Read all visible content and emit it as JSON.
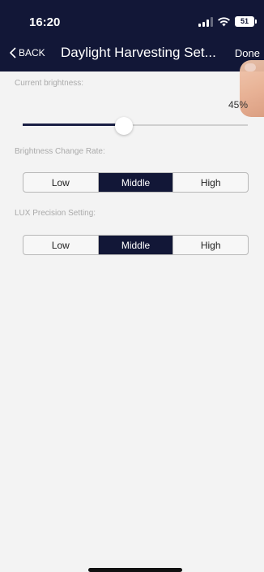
{
  "status_bar": {
    "time": "16:20",
    "battery": "51"
  },
  "nav": {
    "back_label": "BACK",
    "title": "Daylight Harvesting Set...",
    "done_label": "Done"
  },
  "brightness": {
    "label": "Current brightness:",
    "value_text": "45%",
    "value": 0.45
  },
  "change_rate": {
    "label": "Brightness Change Rate:",
    "options": [
      "Low",
      "Middle",
      "High"
    ],
    "selected": "Middle"
  },
  "lux_precision": {
    "label": "LUX Precision Setting:",
    "options": [
      "Low",
      "Middle",
      "High"
    ],
    "selected": "Middle"
  },
  "colors": {
    "header_bg": "#121737",
    "selected_bg": "#121737",
    "page_bg": "#f3f3f3"
  }
}
